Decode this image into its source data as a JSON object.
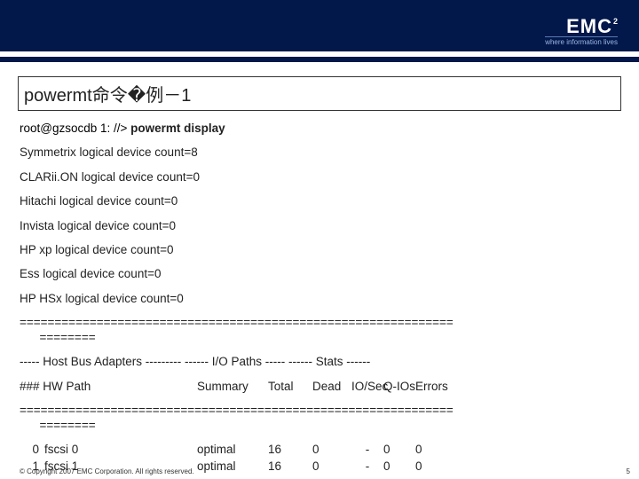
{
  "header": {
    "logo_main": "EMC",
    "logo_sup": "2",
    "logo_tag": "where information lives"
  },
  "title": "powermt命令�例－1",
  "terminal": {
    "prompt": "root@gzsocdb 1: //> ",
    "command": "powermt display",
    "lines": [
      "Symmetrix logical device count=8",
      "CLARii.ON logical device count=0",
      "Hitachi logical device count=0",
      "Invista logical device count=0",
      "HP xp logical device count=0",
      "Ess logical device count=0",
      "HP HSx logical device count=0"
    ],
    "rule_long": "==============================================================",
    "rule_short": "========",
    "headerline": "----- Host Bus Adapters --------- ------ I/O Paths ----- ------ Stats ------",
    "colhdr_left": "###  HW Path",
    "cols": [
      "Summary",
      "Total",
      "Dead",
      "IO/Sec",
      "Q-IOs",
      "Errors"
    ]
  },
  "rows": [
    {
      "idx": "0",
      "path": "fscsi 0",
      "summary": "optimal",
      "total": "16",
      "dead": "0",
      "iosec": "-",
      "qios": "0",
      "errors": "0"
    },
    {
      "idx": "1",
      "path": "fscsi 1",
      "summary": "optimal",
      "total": "16",
      "dead": "0",
      "iosec": "-",
      "qios": "0",
      "errors": "0"
    }
  ],
  "footer": "© Copyright 2007 EMC Corporation. All rights reserved.",
  "page_number": "5"
}
